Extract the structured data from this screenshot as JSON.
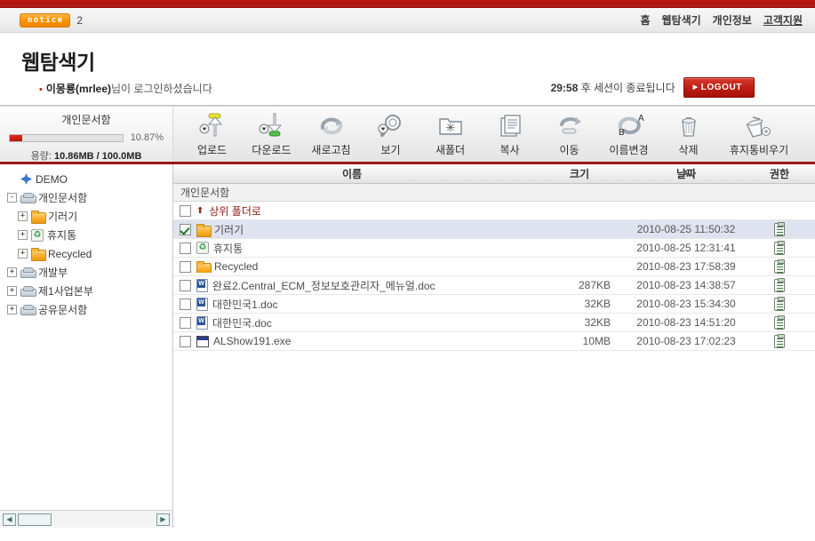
{
  "utility": {
    "notice_badge": "notice",
    "notice_count": "2",
    "gnb": [
      {
        "label": "홈",
        "active": false
      },
      {
        "label": "웹탐색기",
        "active": false
      },
      {
        "label": "개인정보",
        "active": false
      },
      {
        "label": "고객지원",
        "active": true
      }
    ]
  },
  "header": {
    "page_title": "웹탐색기",
    "login_user": "이몽룡(mrlee)",
    "login_suffix": "님이 로그인하셨습니다",
    "session_time": "29:58",
    "session_text": " 후 세션이 종료됩니다",
    "logout_label": "LOGOUT"
  },
  "quota": {
    "title": "개인문서함",
    "percent_label": "10.87%",
    "percent_value": 10.87,
    "size_label": "용량:",
    "size_value": "10.86MB / 100.0MB"
  },
  "toolbar": {
    "items": [
      {
        "label": "업로드",
        "icon": "upload-icon"
      },
      {
        "label": "다운로드",
        "icon": "download-icon"
      },
      {
        "label": "새로고침",
        "icon": "refresh-icon"
      },
      {
        "label": "보기",
        "icon": "view-search-icon"
      },
      {
        "label": "새폴더",
        "icon": "new-folder-icon"
      },
      {
        "label": "복사",
        "icon": "copy-icon"
      },
      {
        "label": "이동",
        "icon": "move-icon"
      },
      {
        "label": "이름변경",
        "icon": "rename-icon"
      },
      {
        "label": "삭제",
        "icon": "delete-trash-icon"
      },
      {
        "label": "휴지통비우기",
        "icon": "empty-trash-icon"
      }
    ]
  },
  "tree": {
    "nodes": [
      {
        "label": "DEMO",
        "level": 1,
        "expander": "",
        "icon": "demo-node-icon"
      },
      {
        "label": "개인문서함",
        "level": 1,
        "expander": "-",
        "icon": "drive-icon"
      },
      {
        "label": "기러기",
        "level": 2,
        "expander": "+",
        "icon": "folder-icon"
      },
      {
        "label": "휴지통",
        "level": 2,
        "expander": "+",
        "icon": "recycle-bin-icon"
      },
      {
        "label": "Recycled",
        "level": 2,
        "expander": "+",
        "icon": "folder-icon"
      },
      {
        "label": "개발부",
        "level": 1,
        "expander": "+",
        "icon": "drive-icon"
      },
      {
        "label": "제1사업본부",
        "level": 1,
        "expander": "+",
        "icon": "drive-icon"
      },
      {
        "label": "공유문서함",
        "level": 1,
        "expander": "+",
        "icon": "drive-icon"
      }
    ]
  },
  "list": {
    "columns": {
      "name": "이름",
      "size": "크기",
      "date": "날짜",
      "perm": "권한"
    },
    "current_path": "개인문서함",
    "parent_link": "상위 폴더로",
    "rows": [
      {
        "name": "기러기",
        "icon": "folder-icon",
        "size": "",
        "date": "2010-08-25 11:50:32",
        "checked": true,
        "selected": true
      },
      {
        "name": "휴지통",
        "icon": "recycle-bin-icon",
        "size": "",
        "date": "2010-08-25 12:31:41",
        "checked": false,
        "selected": false
      },
      {
        "name": "Recycled",
        "icon": "folder-icon",
        "size": "",
        "date": "2010-08-23 17:58:39",
        "checked": false,
        "selected": false
      },
      {
        "name": "완료2.Central_ECM_정보보호관리자_메뉴얼.doc",
        "icon": "word-doc-icon",
        "size": "287KB",
        "date": "2010-08-23 14:38:57",
        "checked": false,
        "selected": false
      },
      {
        "name": "대한민국1.doc",
        "icon": "word-doc-icon",
        "size": "32KB",
        "date": "2010-08-23 15:34:30",
        "checked": false,
        "selected": false
      },
      {
        "name": "대한민국.doc",
        "icon": "word-doc-icon",
        "size": "32KB",
        "date": "2010-08-23 14:51:20",
        "checked": false,
        "selected": false
      },
      {
        "name": "ALShow191.exe",
        "icon": "exe-icon",
        "size": "10MB",
        "date": "2010-08-23 17:02:23",
        "checked": false,
        "selected": false
      }
    ]
  },
  "colors": {
    "brand_red": "#a81510",
    "accent_orange": "#f79400",
    "selection_blue": "#dfe3ef",
    "link_maroon": "#8c2218"
  }
}
